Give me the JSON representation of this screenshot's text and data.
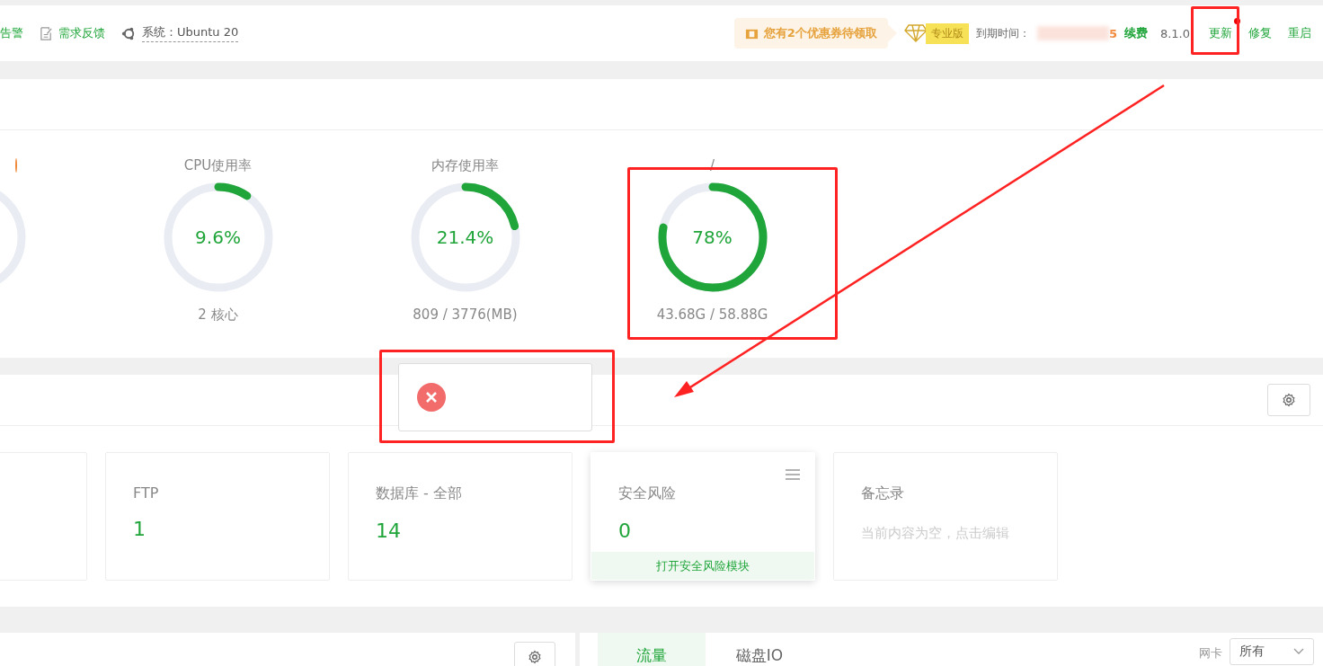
{
  "header": {
    "left_items": [
      {
        "kind": "plain",
        "label": "告警"
      },
      {
        "kind": "doc",
        "label": "需求反馈"
      },
      {
        "kind": "system",
        "label": "系统：Ubuntu 20"
      }
    ],
    "coupon": "您有2个优惠券待领取",
    "edition": "专业版",
    "expiry_label": "到期时间：",
    "expiry_value_tail": "5",
    "renew": "续费",
    "version": "8.1.0",
    "actions": [
      {
        "label": "更新",
        "badge": true
      },
      {
        "label": "修复",
        "badge": false
      },
      {
        "label": "重启",
        "badge": false
      }
    ]
  },
  "gauges": [
    {
      "kind": "partial"
    },
    {
      "kind": "ring",
      "title": "CPU使用率",
      "value": "9.6%",
      "level": 0.096,
      "detail": "2 核心"
    },
    {
      "kind": "ring",
      "title": "内存使用率",
      "value": "21.4%",
      "level": 0.214,
      "detail": "809 / 3776(MB)"
    },
    {
      "kind": "ring",
      "title": "/",
      "value": "78%",
      "level": 0.78,
      "detail": "43.68G / 58.88G"
    }
  ],
  "cards": [
    {
      "kind": "partial"
    },
    {
      "kind": "count",
      "title": "FTP",
      "value": "1"
    },
    {
      "kind": "count",
      "title": "数据库 - 全部",
      "value": "14"
    },
    {
      "kind": "module",
      "title": "安全风险",
      "value": "0",
      "footer": "打开安全风险模块"
    },
    {
      "kind": "memo",
      "title": "备忘录",
      "placeholder": "当前内容为空，点击编辑"
    }
  ],
  "traffic": {
    "tabs": [
      {
        "label": "流量",
        "selected": true
      },
      {
        "label": "磁盘IO",
        "selected": false
      }
    ],
    "nic_label": "网卡",
    "nic_value": "所有"
  }
}
